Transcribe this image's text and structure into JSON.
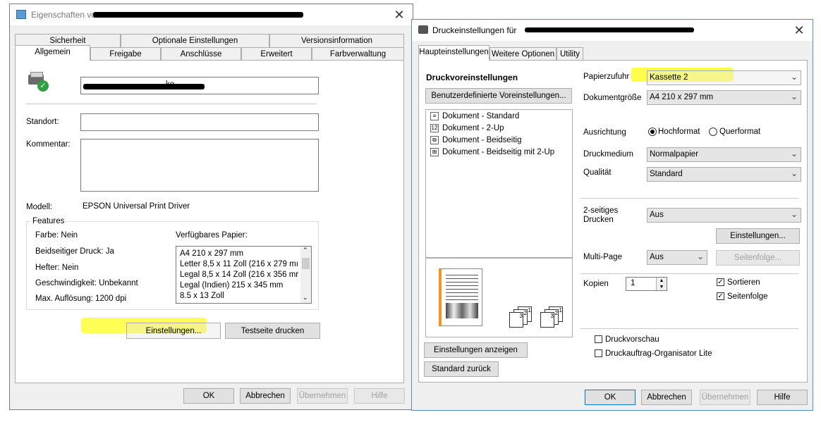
{
  "left_window": {
    "title": "Eigenschaften vo",
    "tabs_row1": [
      "Sicherheit",
      "Optionale Einstellungen",
      "Versionsinformation"
    ],
    "tabs_row2": [
      "Allgemein",
      "Freigabe",
      "Anschlüsse",
      "Erweitert",
      "Farbverwaltung"
    ],
    "printer_name_suffix": "ko",
    "location_label": "Standort:",
    "comment_label": "Kommentar:",
    "model_label": "Modell:",
    "model_value": "EPSON Universal Print Driver",
    "features_title": "Features",
    "features": {
      "color": "Farbe: Nein",
      "duplex": "Beidseitiger Druck: Ja",
      "stapler": "Hefter: Nein",
      "speed": "Geschwindigkeit: Unbekannt",
      "resolution": "Max. Auflösung: 1200 dpi"
    },
    "paper_label": "Verfügbares Papier:",
    "paper_list": [
      "A4 210 x 297 mm",
      "Letter 8,5 x 11 Zoll (216 x 279 mı",
      "Legal 8,5 x 14 Zoll (216 x 356 mr",
      "Legal (Indien) 215 x 345 mm",
      "8.5 x 13 Zoll"
    ],
    "settings_button": "Einstellungen...",
    "testpage_button": "Testseite drucken",
    "ok_button": "OK",
    "cancel_button": "Abbrechen",
    "apply_button": "Übernehmen",
    "help_button": "Hilfe",
    "highlight_color": "#ffff2b"
  },
  "right_window": {
    "title": "Druckeinstellungen für",
    "tabs": [
      "Haupteinstellungen",
      "Weitere Optionen",
      "Utility"
    ],
    "presets_title": "Druckvoreinstellungen",
    "custom_presets_button": "Benutzerdefinierte Voreinstellungen...",
    "presets": [
      "Dokument - Standard",
      "Dokument - 2-Up",
      "Dokument - Beidseitig",
      "Dokument - Beidseitig mit 2-Up"
    ],
    "preset_icons": [
      "document-icon",
      "two-up-icon",
      "duplex-icon",
      "duplex-two-up-icon"
    ],
    "show_settings_button": "Einstellungen anzeigen",
    "reset_button": "Standard zurück",
    "paper_source_label": "Papierzufuhr",
    "paper_source_value": "Kassette 2",
    "doc_size_label": "Dokumentgröße",
    "doc_size_value": "A4 210 x 297 mm",
    "orientation_label": "Ausrichtung",
    "portrait_label": "Hochformat",
    "landscape_label": "Querformat",
    "media_label": "Druckmedium",
    "media_value": "Normalpapier",
    "quality_label": "Qualität",
    "quality_value": "Standard",
    "duplex_label": "2-seitiges\nDrucken",
    "duplex_value": "Aus",
    "duplex_settings_button": "Einstellungen...",
    "multipage_label": "Multi-Page",
    "multipage_value": "Aus",
    "page_order_button": "Seitenfolge...",
    "copies_label": "Kopien",
    "copies_value": "1",
    "collate_label": "Sortieren",
    "reverse_label": "Seitenfolge",
    "preview_label": "Druckvorschau",
    "job_arranger_label": "Druckauftrag-Organisator Lite",
    "ok_button": "OK",
    "cancel_button": "Abbrechen",
    "apply_button": "Übernehmen",
    "help_button": "Hilfe",
    "accent_color": "#f7941d"
  }
}
